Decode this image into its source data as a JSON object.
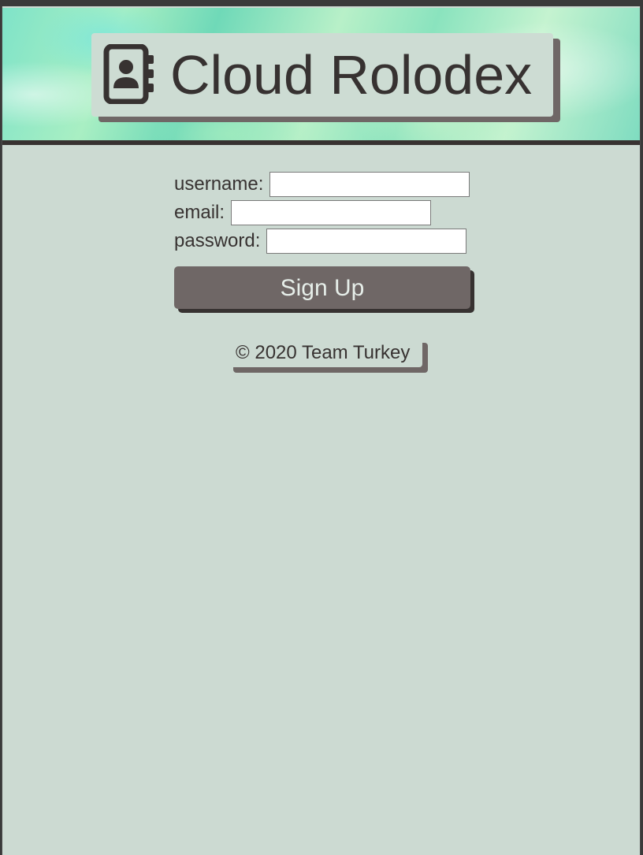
{
  "header": {
    "title": "Cloud Rolodex",
    "icon": "address-book-icon"
  },
  "form": {
    "username_label": "username:",
    "username_value": "",
    "email_label": "email:",
    "email_value": "",
    "password_label": "password:",
    "password_value": "",
    "submit_label": "Sign Up"
  },
  "footer": {
    "text": "© 2020 Team Turkey"
  },
  "colors": {
    "background": "#ccdad2",
    "text": "#373231",
    "button": "#6f6766",
    "button_text": "#e6eee9"
  }
}
